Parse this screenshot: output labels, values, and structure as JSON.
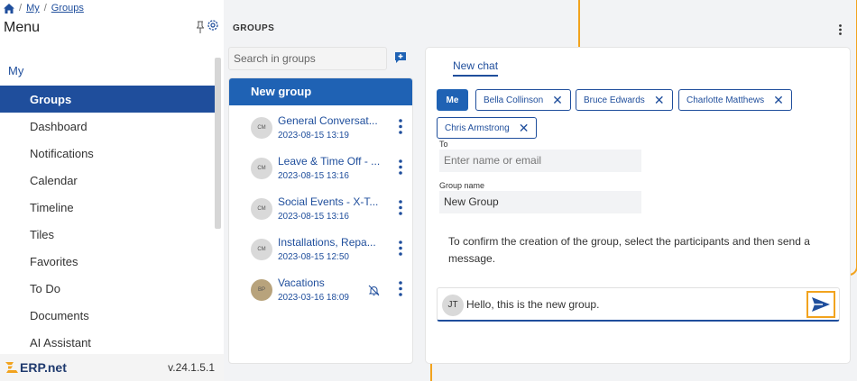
{
  "breadcrumb": {
    "items": [
      "My",
      "Groups"
    ]
  },
  "sidebar": {
    "title": "Menu",
    "section": "My",
    "items": [
      {
        "label": "Groups",
        "active": true
      },
      {
        "label": "Dashboard"
      },
      {
        "label": "Notifications"
      },
      {
        "label": "Calendar"
      },
      {
        "label": "Timeline"
      },
      {
        "label": "Tiles"
      },
      {
        "label": "Favorites"
      },
      {
        "label": "To Do"
      },
      {
        "label": "Documents"
      },
      {
        "label": "AI Assistant"
      }
    ],
    "logo": "ERP.net",
    "version": "v.24.1.5.1"
  },
  "groups": {
    "title": "GROUPS",
    "search_placeholder": "Search in groups",
    "new_group_label": "New group",
    "items": [
      {
        "name": "General Conversat...",
        "date": "2023-08-15 13:19",
        "avatar": "CM"
      },
      {
        "name": "Leave & Time Off - ...",
        "date": "2023-08-15 13:16",
        "avatar": "CM"
      },
      {
        "name": "Social Events - X-T...",
        "date": "2023-08-15 13:16",
        "avatar": "CM"
      },
      {
        "name": "Installations, Repa...",
        "date": "2023-08-15 12:50",
        "avatar": "CM"
      },
      {
        "name": "Vacations",
        "date": "2023-03-16 18:09",
        "avatar": "BP",
        "muted": true
      }
    ]
  },
  "chat": {
    "tab_label": "New chat",
    "participants": [
      "Me",
      "Bella Collinson",
      "Bruce Edwards",
      "Charlotte Matthews",
      "Chris Armstrong"
    ],
    "to_label": "To",
    "to_placeholder": "Enter name or email",
    "group_name_label": "Group name",
    "group_name_value": "New Group",
    "confirm_text": "To confirm the creation of the group, select the participants and then send a message.",
    "composer_initials": "JT",
    "composer_text": "Hello, this is the new group."
  },
  "colors": {
    "primary": "#1f62b4",
    "link": "#1f4e9c",
    "accent": "#f2a31e"
  }
}
